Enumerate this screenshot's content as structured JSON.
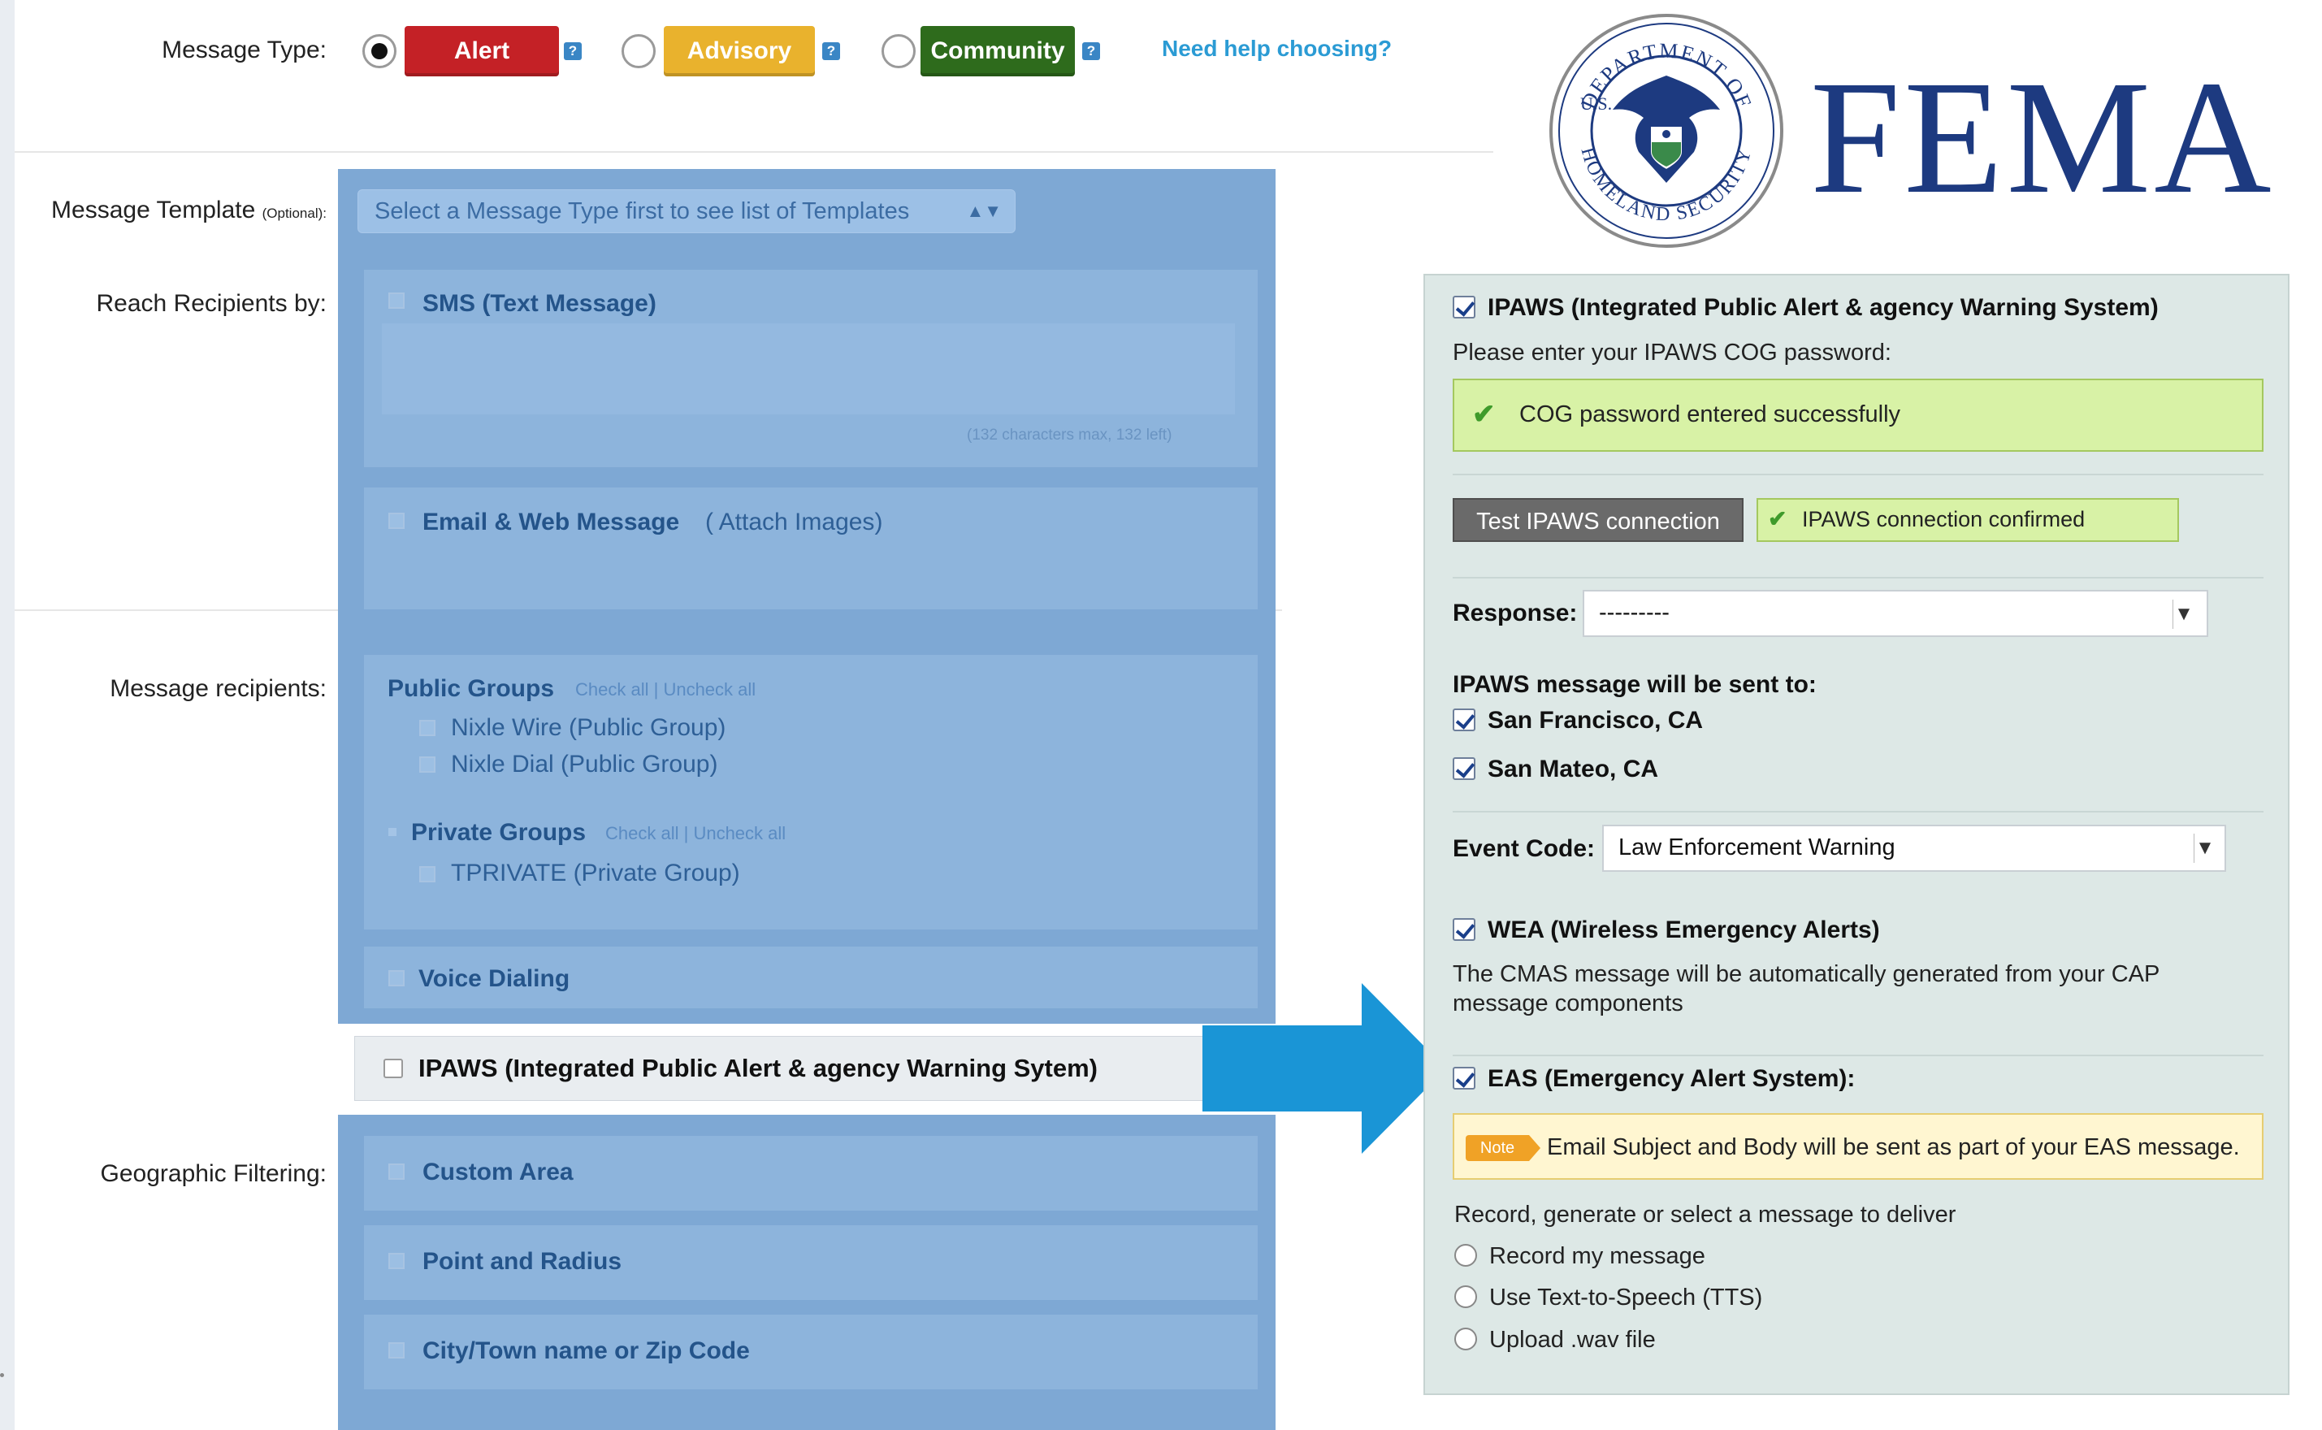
{
  "message_type": {
    "label": "Message Type:",
    "options": [
      {
        "label": "Alert",
        "selected": true,
        "color": "#c42126"
      },
      {
        "label": "Advisory",
        "selected": false,
        "color": "#e9b22d"
      },
      {
        "label": "Community",
        "selected": false,
        "color": "#2e6b1c"
      }
    ],
    "help_link": "Need help choosing?"
  },
  "message_template": {
    "label": "Message Template",
    "label_suffix": "(Optional):",
    "select_value": "Select a Message Type first to see list of Templates"
  },
  "reach_recipients": {
    "label": "Reach Recipients by:",
    "sms_label": "SMS (Text Message)",
    "sms_counter": "(132 characters max, 132 left)",
    "email_label": "Email & Web Message",
    "attach_images": "Attach Images",
    "voice_label": "Voice Dialing",
    "ipaws_label": "IPAWS (Integrated Public Alert & agency Warning Sytem)"
  },
  "message_recipients": {
    "label": "Message recipients:",
    "public_groups": "Public Groups",
    "check_all": "Check all",
    "uncheck_all": "Uncheck all",
    "sep": "|",
    "public_items": [
      "Nixle Wire (Public Group)",
      "Nixle Dial (Public Group)"
    ],
    "private_groups": "Private Groups",
    "private_items": [
      "TPRIVATE (Private Group)"
    ]
  },
  "geo_filtering": {
    "label": "Geographic Filtering:",
    "items": [
      "Custom Area",
      "Point and Radius",
      "City/Town name or Zip Code"
    ]
  },
  "logo": {
    "text": "FEMA",
    "seal_top": "DEPARTMENT OF",
    "seal_left": "U.S.",
    "seal_bottom": "HOMELAND SECURITY",
    "color": "#1d3a80"
  },
  "ipaws_panel": {
    "title": "IPAWS (Integrated Public Alert & agency Warning System)",
    "password_prompt": "Please enter your IPAWS COG password:",
    "cog_success": "COG password entered successfully",
    "test_button": "Test IPAWS connection",
    "connection_confirmed": "IPAWS connection confirmed",
    "response_label": "Response:",
    "response_value": "---------",
    "sent_to_label": "IPAWS message will be sent to:",
    "locations": [
      "San Francisco, CA",
      "San Mateo, CA"
    ],
    "event_code_label": "Event Code:",
    "event_code_value": "Law Enforcement Warning",
    "wea_label": "WEA (Wireless Emergency Alerts)",
    "wea_desc_1": "The CMAS message will be automatically generated from your CAP",
    "wea_desc_2": "message components",
    "eas_label": "EAS (Emergency Alert System):",
    "note_badge": "Note",
    "note_text": "Email Subject and Body will be sent as part of your EAS message.",
    "record_prompt": "Record, generate or select a message to deliver",
    "delivery_options": [
      "Record my message",
      "Use Text-to-Speech (TTS)",
      "Upload .wav file"
    ]
  },
  "colors": {
    "overlay_blue": "#7ea8d4",
    "arrow_blue": "#1a95d6",
    "success_green": "#d8f2a6",
    "note_yellow": "#fff6d1"
  }
}
